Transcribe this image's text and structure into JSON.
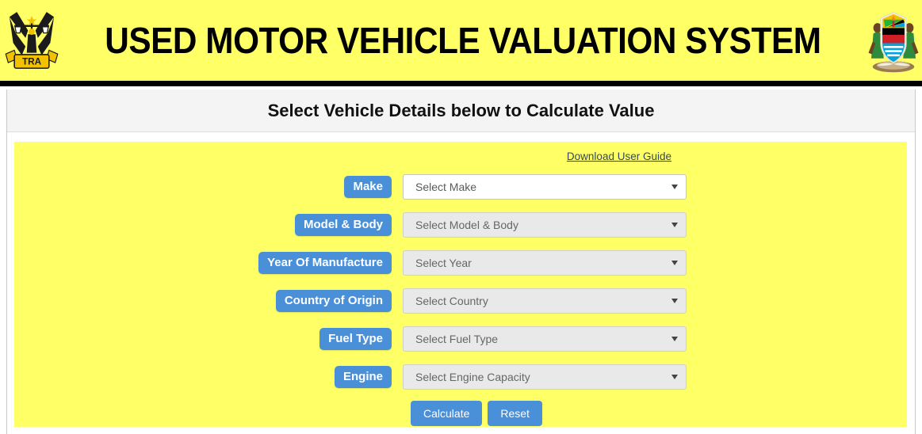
{
  "header": {
    "title": "USED MOTOR VEHICLE VALUATION SYSTEM",
    "left_logo_name": "tra-scales-of-justice-logo",
    "left_logo_ribbon_text": "TRA",
    "right_logo_name": "tanzania-coat-of-arms",
    "banner_bg": "#ffff66",
    "rule_color": "#000000"
  },
  "panel": {
    "heading": "Select Vehicle Details below to Calculate Value",
    "heading_bg": "#f4f4f4",
    "card_bg": "#ffff66"
  },
  "guide": {
    "link_label": "Download User Guide",
    "link_color": "#34495e"
  },
  "form": {
    "accent_color": "#4a90d9",
    "fields": [
      {
        "label": "Make",
        "placeholder": "Select Make",
        "name": "make",
        "enabled": true
      },
      {
        "label": "Model & Body",
        "placeholder": "Select Model & Body",
        "name": "model-body",
        "enabled": false
      },
      {
        "label": "Year Of Manufacture",
        "placeholder": "Select Year",
        "name": "year-of-manufacture",
        "enabled": false
      },
      {
        "label": "Country of Origin",
        "placeholder": "Select Country",
        "name": "country-of-origin",
        "enabled": false
      },
      {
        "label": "Fuel Type",
        "placeholder": "Select Fuel Type",
        "name": "fuel-type",
        "enabled": false
      },
      {
        "label": "Engine",
        "placeholder": "Select Engine Capacity",
        "name": "engine",
        "enabled": false
      }
    ]
  },
  "buttons": {
    "calculate_label": "Calculate",
    "reset_label": "Reset"
  }
}
